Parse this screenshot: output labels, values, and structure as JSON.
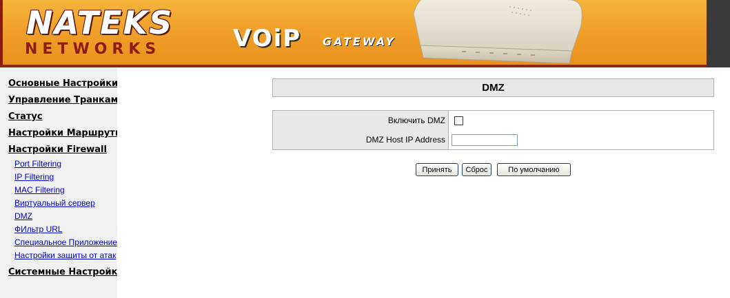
{
  "header": {
    "brand_top": "NATEKS",
    "brand_bottom": "NETWORKS",
    "product": "VOiP",
    "product_sub": "GATEWAY"
  },
  "sidebar": {
    "main_items": [
      {
        "label": "Основные Настройки"
      },
      {
        "label": "Управление Транками"
      },
      {
        "label": "Статус"
      },
      {
        "label": "Настройки Маршрутизации"
      },
      {
        "label": "Настройки Firewall"
      },
      {
        "label": "Системные Настройки"
      }
    ],
    "firewall_items": [
      {
        "label": "Port Filtering"
      },
      {
        "label": "IP Filtering"
      },
      {
        "label": "MAC Filtering"
      },
      {
        "label": "Виртуальный сервер"
      },
      {
        "label": "DMZ"
      },
      {
        "label": "ФИльтр URL"
      },
      {
        "label": "Специальное Приложение"
      },
      {
        "label": "Настройки защиты от атак"
      }
    ]
  },
  "main": {
    "title": "DMZ",
    "fields": {
      "enable_dmz_label": "Включить DMZ",
      "enable_dmz_checked": false,
      "host_ip_label": "DMZ Host IP Address",
      "host_ip_value": ""
    },
    "buttons": {
      "apply": "Принять",
      "reset": "Сброс",
      "default": "По умолчанию"
    }
  },
  "colors": {
    "banner_orange": "#f0a02a",
    "brand_red": "#8e1c14",
    "sidebar_bg": "#f0f0f0",
    "link_blue": "#0000cc",
    "header_cell_bg": "#e8e8e8"
  }
}
